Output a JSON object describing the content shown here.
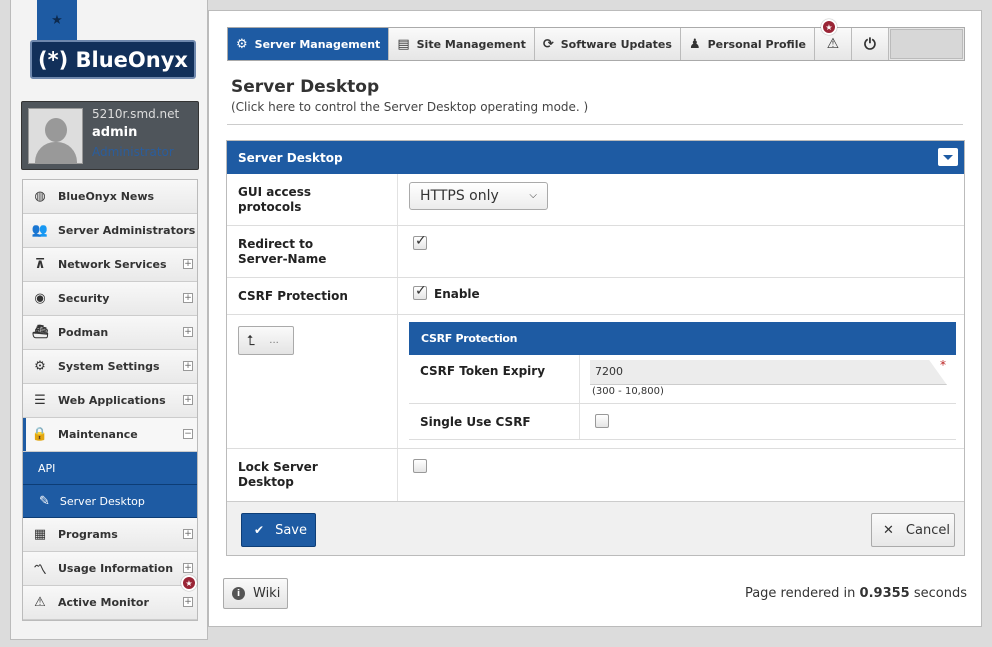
{
  "brand": {
    "logo_text": "(*) BlueOnyx"
  },
  "user": {
    "host": "5210r.smd.net",
    "name": "admin",
    "role": "Administrator"
  },
  "sidebar": {
    "items": [
      {
        "label": "BlueOnyx News",
        "icon": "globe-icon"
      },
      {
        "label": "Server Administrators",
        "icon": "users-icon"
      },
      {
        "label": "Network Services",
        "icon": "network-icon"
      },
      {
        "label": "Security",
        "icon": "eye-icon"
      },
      {
        "label": "Podman",
        "icon": "container-icon"
      },
      {
        "label": "System Settings",
        "icon": "gear-icon"
      },
      {
        "label": "Web Applications",
        "icon": "server-icon"
      },
      {
        "label": "Maintenance",
        "icon": "lock-icon"
      },
      {
        "label": "Programs",
        "icon": "chip-icon"
      },
      {
        "label": "Usage Information",
        "icon": "chart-icon"
      },
      {
        "label": "Active Monitor",
        "icon": "warning-icon"
      }
    ],
    "sub_items": [
      {
        "label": "API"
      },
      {
        "label": "Server Desktop",
        "icon": "pencil-icon"
      }
    ]
  },
  "tabs": [
    {
      "label": "Server Management",
      "icon": "gear-icon"
    },
    {
      "label": "Site Management",
      "icon": "grid-icon"
    },
    {
      "label": "Software Updates",
      "icon": "refresh-icon"
    },
    {
      "label": "Personal Profile",
      "icon": "user-icon"
    },
    {
      "label": "",
      "icon": "warning-icon"
    },
    {
      "label": "",
      "icon": "power-icon"
    }
  ],
  "page": {
    "title": "Server Desktop",
    "hint": "(Click here to control the Server Desktop operating mode. )"
  },
  "panel": {
    "title": "Server Desktop",
    "gui_protocols": {
      "label": "GUI access protocols",
      "value": "HTTPS only"
    },
    "redirect": {
      "label": "Redirect to Server-Name",
      "checked": true
    },
    "csrf": {
      "label": "CSRF Protection",
      "checked": true,
      "option_label": "Enable"
    },
    "back_button": {
      "label": "..."
    },
    "csrf_sub": {
      "title": "CSRF Protection",
      "expiry": {
        "label": "CSRF Token Expiry",
        "value": "7200",
        "hint": "(300 - 10,800)"
      },
      "single_use": {
        "label": "Single Use CSRF",
        "checked": false
      }
    },
    "lock": {
      "label": "Lock Server Desktop",
      "checked": false
    }
  },
  "buttons": {
    "save": "Save",
    "cancel": "Cancel",
    "wiki": "Wiki"
  },
  "footer": {
    "render_prefix": "Page rendered in",
    "render_value": "0.9355",
    "render_suffix": "seconds"
  },
  "colors": {
    "accent": "#1e5ba3",
    "badge": "#9a2536"
  }
}
